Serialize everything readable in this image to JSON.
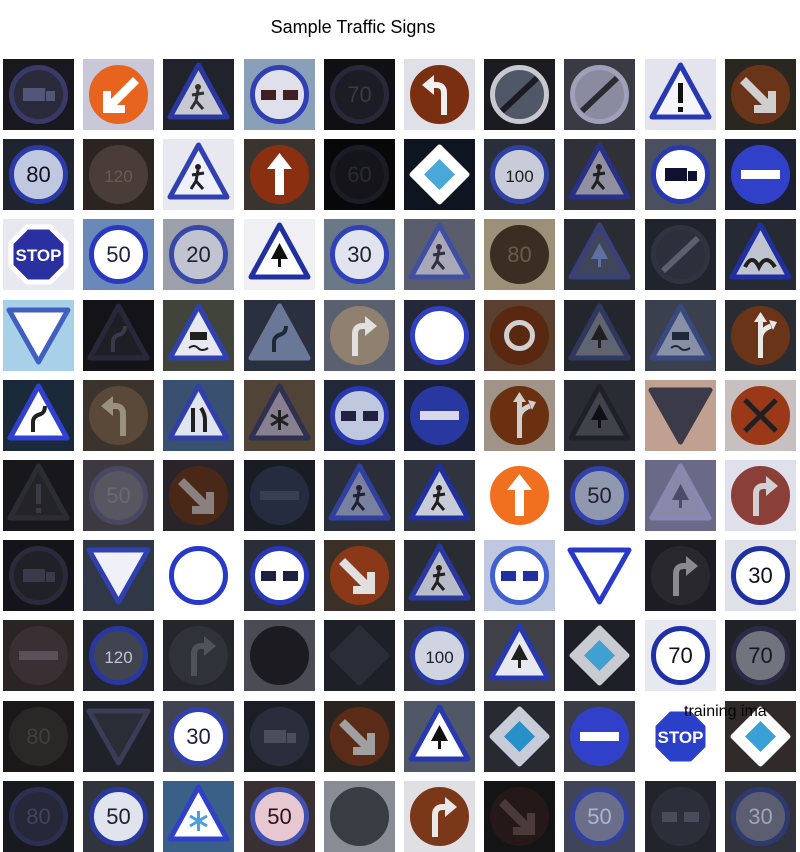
{
  "title": "Sample Traffic Signs",
  "caption": "training ima",
  "tiles": [
    {
      "shape": "circle",
      "sym": "truck",
      "bg": "#18181e",
      "fill": "#2a2a3a",
      "ring": "#3a3a6a",
      "ink": "#55557a"
    },
    {
      "shape": "circle",
      "sym": "arrow-dl",
      "bg": "#c8c8d8",
      "fill": "#e8641e",
      "ring": "#e8641e",
      "ink": "#ffffff"
    },
    {
      "shape": "triangle",
      "sym": "person",
      "bg": "#20222c",
      "fill": "#c8c8d0",
      "ring": "#2838a0",
      "ink": "#303030"
    },
    {
      "shape": "circle",
      "sym": "overtake",
      "bg": "#8aa0b8",
      "fill": "#e0e0ec",
      "ring": "#3040b0",
      "ink": "#402020"
    },
    {
      "shape": "circle",
      "sym": "70",
      "bg": "#101014",
      "fill": "#1c1c24",
      "ring": "#28283a",
      "ink": "#3a3a48"
    },
    {
      "shape": "circle",
      "sym": "curve-left",
      "bg": "#e0e0e8",
      "fill": "#7a3010",
      "ring": "#7a3010",
      "ink": "#f0f0f0"
    },
    {
      "shape": "circle",
      "sym": "noentry-diag",
      "bg": "#1a1c22",
      "fill": "#505868",
      "ring": "#c8c8d0",
      "ink": "#1a1c22"
    },
    {
      "shape": "circle",
      "sym": "end",
      "bg": "#3a3a44",
      "fill": "#8a8aa0",
      "ring": "#a0a0b8",
      "ink": "#2a2a30"
    },
    {
      "shape": "triangle",
      "sym": "excl",
      "bg": "#e4e4ee",
      "fill": "#f4f4fa",
      "ring": "#2838b0",
      "ink": "#101010"
    },
    {
      "shape": "circle",
      "sym": "arrow-dr",
      "bg": "#2a2620",
      "fill": "#6a3418",
      "ring": "#6a3418",
      "ink": "#cfcfcf"
    },
    {
      "shape": "circle",
      "sym": "80",
      "bg": "#20242e",
      "fill": "#c0c8e0",
      "ring": "#2a3aa8",
      "ink": "#101020"
    },
    {
      "shape": "circle",
      "sym": "120",
      "bg": "#2c2420",
      "fill": "#4a3c38",
      "ring": "#4a3c38",
      "ink": "#6a5a50"
    },
    {
      "shape": "triangle",
      "sym": "roadwork",
      "bg": "#e8e8f0",
      "fill": "#f0f0f8",
      "ring": "#3040b0",
      "ink": "#202020"
    },
    {
      "shape": "circle",
      "sym": "arrow-up",
      "bg": "#3a3430",
      "fill": "#8a3010",
      "ring": "#8a3010",
      "ink": "#ffffff"
    },
    {
      "shape": "circle",
      "sym": "60",
      "bg": "#08080a",
      "fill": "#14141a",
      "ring": "#1c1c26",
      "ink": "#2a2a34"
    },
    {
      "shape": "diamond",
      "sym": "priority",
      "bg": "#0e1420",
      "fill": "#ffffff",
      "ring": "#ffffff",
      "ink": "#4aa8d8"
    },
    {
      "shape": "circle",
      "sym": "100",
      "bg": "#2a2e38",
      "fill": "#c8ccd8",
      "ring": "#3040a0",
      "ink": "#202020"
    },
    {
      "shape": "triangle",
      "sym": "person",
      "bg": "#303038",
      "fill": "#9090a0",
      "ring": "#283088",
      "ink": "#202020"
    },
    {
      "shape": "circle",
      "sym": "truck",
      "bg": "#4a5060",
      "fill": "#ffffff",
      "ring": "#2838b0",
      "ink": "#101030"
    },
    {
      "shape": "circle",
      "sym": "noentry",
      "bg": "#1c2030",
      "fill": "#3040c8",
      "ring": "#3040c8",
      "ink": "#ffffff"
    },
    {
      "shape": "octagon",
      "sym": "stop",
      "bg": "#e8e8f0",
      "fill": "#2a30a0",
      "ring": "#ffffff",
      "ink": "#ffffff"
    },
    {
      "shape": "circle",
      "sym": "50",
      "bg": "#6a88b8",
      "fill": "#ffffff",
      "ring": "#2838c0",
      "ink": "#202040"
    },
    {
      "shape": "circle",
      "sym": "20",
      "bg": "#9ca0aa",
      "fill": "#c0c4d0",
      "ring": "#3848a8",
      "ink": "#202030"
    },
    {
      "shape": "triangle",
      "sym": "tree",
      "bg": "#f0f0f4",
      "fill": "#ffffff",
      "ring": "#2030a0",
      "ink": "#101010"
    },
    {
      "shape": "circle",
      "sym": "30",
      "bg": "#6a7888",
      "fill": "#e0e4ee",
      "ring": "#3040b8",
      "ink": "#202030"
    },
    {
      "shape": "triangle",
      "sym": "person",
      "bg": "#5a5e6c",
      "fill": "#a8a8b8",
      "ring": "#4050a0",
      "ink": "#303040"
    },
    {
      "shape": "circle",
      "sym": "80",
      "bg": "#9c9078",
      "fill": "#3a2e22",
      "ring": "#3a2e22",
      "ink": "#6a5a48"
    },
    {
      "shape": "triangle",
      "sym": "tree",
      "bg": "#2a2c34",
      "fill": "#40465a",
      "ring": "#3a4078",
      "ink": "#6070a0"
    },
    {
      "shape": "circle",
      "sym": "end",
      "bg": "#20242c",
      "fill": "#2c303a",
      "ring": "#303440",
      "ink": "#5a6070"
    },
    {
      "shape": "triangle",
      "sym": "bumps",
      "bg": "#262a34",
      "fill": "#c0c4d0",
      "ring": "#2030a0",
      "ink": "#202020"
    },
    {
      "shape": "triangle-down",
      "sym": "",
      "bg": "#a8d0e8",
      "fill": "#ffffff",
      "ring": "#4060c0",
      "ink": "#ffffff"
    },
    {
      "shape": "triangle",
      "sym": "curve",
      "bg": "#141418",
      "fill": "#1e1e24",
      "ring": "#28283a",
      "ink": "#3a3a4a"
    },
    {
      "shape": "triangle",
      "sym": "slip",
      "bg": "#40443a",
      "fill": "#e8e8f0",
      "ring": "#3040b0",
      "ink": "#202020"
    },
    {
      "shape": "triangle",
      "sym": "curve",
      "bg": "#2a3040",
      "fill": "#6a7898",
      "ring": "#6a7898",
      "ink": "#202838"
    },
    {
      "shape": "circle",
      "sym": "curve-right",
      "bg": "#5a6070",
      "fill": "#908070",
      "ring": "#908070",
      "ink": "#e0e0e0"
    },
    {
      "shape": "circle",
      "sym": "",
      "bg": "#24283a",
      "fill": "#ffffff",
      "ring": "#3040c0",
      "ink": "#ffffff"
    },
    {
      "shape": "circle",
      "sym": "roundabout",
      "bg": "#5a4030",
      "fill": "#5a2810",
      "ring": "#5a2810",
      "ink": "#d0d0d0"
    },
    {
      "shape": "triangle",
      "sym": "tree",
      "bg": "#24262e",
      "fill": "#606470",
      "ring": "#303860",
      "ink": "#202020"
    },
    {
      "shape": "triangle",
      "sym": "slip",
      "bg": "#3a404e",
      "fill": "#8890a8",
      "ring": "#3a4880",
      "ink": "#202838"
    },
    {
      "shape": "circle",
      "sym": "fork",
      "bg": "#2a2c34",
      "fill": "#6a3418",
      "ring": "#6a3418",
      "ink": "#e8e8e8"
    },
    {
      "shape": "triangle",
      "sym": "curve",
      "bg": "#1a2a3a",
      "fill": "#ffffff",
      "ring": "#3040d0",
      "ink": "#202020"
    },
    {
      "shape": "circle",
      "sym": "curve-left",
      "bg": "#3a342c",
      "fill": "#5a4838",
      "ring": "#5a4838",
      "ink": "#9a9080"
    },
    {
      "shape": "triangle",
      "sym": "narrow",
      "bg": "#3a5070",
      "fill": "#e0e4ee",
      "ring": "#3040a8",
      "ink": "#202020"
    },
    {
      "shape": "triangle",
      "sym": "snow",
      "bg": "#504438",
      "fill": "#888090",
      "ring": "#303050",
      "ink": "#202020"
    },
    {
      "shape": "circle",
      "sym": "overtake",
      "bg": "#20283a",
      "fill": "#c0c8e0",
      "ring": "#2838b0",
      "ink": "#202040"
    },
    {
      "shape": "circle",
      "sym": "noentry",
      "bg": "#1c2034",
      "fill": "#2838a0",
      "ring": "#2838a0",
      "ink": "#d8d8e8"
    },
    {
      "shape": "circle",
      "sym": "fork",
      "bg": "#a09488",
      "fill": "#6a3010",
      "ring": "#6a3010",
      "ink": "#d0d0d0"
    },
    {
      "shape": "triangle",
      "sym": "tree",
      "bg": "#2a2c34",
      "fill": "#40424c",
      "ring": "#202028",
      "ink": "#101014"
    },
    {
      "shape": "triangle-down",
      "sym": "",
      "bg": "#c0a090",
      "fill": "#3a3a48",
      "ring": "#3a3a48",
      "ink": "#3a3a48"
    },
    {
      "shape": "circle",
      "sym": "nostop",
      "bg": "#c8c0c0",
      "fill": "#9a3818",
      "ring": "#9a3818",
      "ink": "#202020"
    },
    {
      "shape": "triangle",
      "sym": "excl",
      "bg": "#18181c",
      "fill": "#242428",
      "ring": "#2c2c34",
      "ink": "#3a3a44"
    },
    {
      "shape": "circle",
      "sym": "50",
      "bg": "#3c3a40",
      "fill": "#585660",
      "ring": "#4a4860",
      "ink": "#6a6870"
    },
    {
      "shape": "circle",
      "sym": "arrow-dr",
      "bg": "#28242a",
      "fill": "#4a2818",
      "ring": "#4a2818",
      "ink": "#8a8080"
    },
    {
      "shape": "circle",
      "sym": "noentry",
      "bg": "#1a1c24",
      "fill": "#262c40",
      "ring": "#262c40",
      "ink": "#3a3e50"
    },
    {
      "shape": "triangle",
      "sym": "person",
      "bg": "#2a2e3a",
      "fill": "#7a80a0",
      "ring": "#3040a0",
      "ink": "#202030"
    },
    {
      "shape": "triangle",
      "sym": "roadwork",
      "bg": "#30343e",
      "fill": "#c8ccd8",
      "ring": "#2030a0",
      "ink": "#202020"
    },
    {
      "shape": "circle",
      "sym": "arrow-up",
      "bg": "#ffffff",
      "fill": "#f07020",
      "ring": "#f07020",
      "ink": "#ffffff"
    },
    {
      "shape": "circle",
      "sym": "50",
      "bg": "#2a2c32",
      "fill": "#9098b0",
      "ring": "#3040a8",
      "ink": "#202030"
    },
    {
      "shape": "triangle",
      "sym": "tree",
      "bg": "#6a6a88",
      "fill": "#8888a8",
      "ring": "#8888b0",
      "ink": "#4a4a6a"
    },
    {
      "shape": "circle",
      "sym": "curve-right",
      "bg": "#e0e0ec",
      "fill": "#8a4038",
      "ring": "#8a4038",
      "ink": "#d0d0d0"
    },
    {
      "shape": "circle",
      "sym": "truck",
      "bg": "#14141a",
      "fill": "#202028",
      "ring": "#2a2a3a",
      "ink": "#3a3a4a"
    },
    {
      "shape": "triangle-down",
      "sym": "",
      "bg": "#303848",
      "fill": "#f0f0f8",
      "ring": "#3040b0",
      "ink": "#ffffff"
    },
    {
      "shape": "circle",
      "sym": "",
      "bg": "#ffffff",
      "fill": "#ffffff",
      "ring": "#2838c8",
      "ink": "#ffffff"
    },
    {
      "shape": "circle",
      "sym": "overtake",
      "bg": "#2a2e38",
      "fill": "#ffffff",
      "ring": "#2838b8",
      "ink": "#202040"
    },
    {
      "shape": "circle",
      "sym": "arrow-dr",
      "bg": "#3a3028",
      "fill": "#8a3818",
      "ring": "#8a3818",
      "ink": "#e0e0e0"
    },
    {
      "shape": "triangle",
      "sym": "person",
      "bg": "#2a2c34",
      "fill": "#b8bcc8",
      "ring": "#2838a0",
      "ink": "#202020"
    },
    {
      "shape": "circle",
      "sym": "overtake",
      "bg": "#c0c8e0",
      "fill": "#ffffff",
      "ring": "#4060d0",
      "ink": "#2030a0"
    },
    {
      "shape": "triangle-down",
      "sym": "",
      "bg": "#ffffff",
      "fill": "#ffffff",
      "ring": "#2838c8",
      "ink": "#ffffff"
    },
    {
      "shape": "circle",
      "sym": "curve-right",
      "bg": "#1c1c22",
      "fill": "#28282e",
      "ring": "#28282e",
      "ink": "#8a8a90"
    },
    {
      "shape": "circle",
      "sym": "30",
      "bg": "#e0e0e8",
      "fill": "#ffffff",
      "ring": "#2030a0",
      "ink": "#101020"
    },
    {
      "shape": "circle",
      "sym": "noentry",
      "bg": "#2a2424",
      "fill": "#3a3034",
      "ring": "#3a3034",
      "ink": "#5a5058"
    },
    {
      "shape": "circle",
      "sym": "120",
      "bg": "#24262e",
      "fill": "#404450",
      "ring": "#2838a0",
      "ink": "#c0c4d0"
    },
    {
      "shape": "circle",
      "sym": "curve-right",
      "bg": "#24262c",
      "fill": "#30323a",
      "ring": "#30323a",
      "ink": "#50525a"
    },
    {
      "shape": "circle",
      "sym": "",
      "bg": "#4a4c54",
      "fill": "#1c1c20",
      "ring": "#1c1c20",
      "ink": "#1c1c20"
    },
    {
      "shape": "diamond",
      "sym": "",
      "bg": "#1e2028",
      "fill": "#2a2c38",
      "ring": "#2a2c38",
      "ink": "#3a3c48"
    },
    {
      "shape": "circle",
      "sym": "100",
      "bg": "#30343e",
      "fill": "#d0d4e0",
      "ring": "#2838a0",
      "ink": "#202030"
    },
    {
      "shape": "triangle",
      "sym": "tree",
      "bg": "#404048",
      "fill": "#e8e8f0",
      "ring": "#2838b0",
      "ink": "#202020"
    },
    {
      "shape": "diamond",
      "sym": "priority",
      "bg": "#1e2028",
      "fill": "#c8ccd0",
      "ring": "#c8ccd0",
      "ink": "#40a0d0"
    },
    {
      "shape": "circle",
      "sym": "70",
      "bg": "#e8e8f0",
      "fill": "#ffffff",
      "ring": "#2030a8",
      "ink": "#101020"
    },
    {
      "shape": "circle",
      "sym": "70",
      "bg": "#202228",
      "fill": "#70747e",
      "ring": "#2a2c44",
      "ink": "#181820"
    },
    {
      "shape": "circle",
      "sym": "80",
      "bg": "#1a1818",
      "fill": "#2a2826",
      "ring": "#2a2826",
      "ink": "#40403a"
    },
    {
      "shape": "triangle-down",
      "sym": "",
      "bg": "#20222a",
      "fill": "#2a2c36",
      "ring": "#3a3c58",
      "ink": "#2a2c36"
    },
    {
      "shape": "circle",
      "sym": "30",
      "bg": "#404452",
      "fill": "#ffffff",
      "ring": "#3040b0",
      "ink": "#202040"
    },
    {
      "shape": "circle",
      "sym": "truck",
      "bg": "#1c1e26",
      "fill": "#2a2e3c",
      "ring": "#2a2e3c",
      "ink": "#4a4e5c"
    },
    {
      "shape": "circle",
      "sym": "arrow-dr",
      "bg": "#2a2420",
      "fill": "#5a2c18",
      "ring": "#5a2c18",
      "ink": "#a0a0a0"
    },
    {
      "shape": "triangle",
      "sym": "tree",
      "bg": "#505868",
      "fill": "#ffffff",
      "ring": "#2838b0",
      "ink": "#101010"
    },
    {
      "shape": "diamond",
      "sym": "priority",
      "bg": "#282a32",
      "fill": "#c8ccd8",
      "ring": "#c8ccd8",
      "ink": "#2890c8"
    },
    {
      "shape": "circle",
      "sym": "noentry",
      "bg": "#3a3c48",
      "fill": "#3040c8",
      "ring": "#3040c8",
      "ink": "#ffffff"
    },
    {
      "shape": "octagon",
      "sym": "stop",
      "bg": "#ffffff",
      "fill": "#2a40c8",
      "ring": "#ffffff",
      "ink": "#ffffff"
    },
    {
      "shape": "diamond",
      "sym": "priority",
      "bg": "#302a2a",
      "fill": "#ffffff",
      "ring": "#ffffff",
      "ink": "#3aa0d8"
    },
    {
      "shape": "circle",
      "sym": "80",
      "bg": "#181a20",
      "fill": "#26283a",
      "ring": "#2c3050",
      "ink": "#40445a"
    },
    {
      "shape": "circle",
      "sym": "50",
      "bg": "#30343c",
      "fill": "#e0e4ec",
      "ring": "#2838a0",
      "ink": "#202030"
    },
    {
      "shape": "triangle",
      "sym": "snow",
      "bg": "#3a6088",
      "fill": "#ffffff",
      "ring": "#3040c8",
      "ink": "#4aa0d8"
    },
    {
      "shape": "circle",
      "sym": "50",
      "bg": "#3a3034",
      "fill": "#e8c8d0",
      "ring": "#4050b0",
      "ink": "#301020"
    },
    {
      "shape": "circle",
      "sym": "",
      "bg": "#888c94",
      "fill": "#3a3c44",
      "ring": "#3a3c44",
      "ink": "#3a3c44"
    },
    {
      "shape": "circle",
      "sym": "curve-right",
      "bg": "#e0e0e4",
      "fill": "#7a3818",
      "ring": "#7a3818",
      "ink": "#e8e8e8"
    },
    {
      "shape": "circle",
      "sym": "arrow-dr",
      "bg": "#141416",
      "fill": "#241818",
      "ring": "#241818",
      "ink": "#4a3a3a"
    },
    {
      "shape": "circle",
      "sym": "50",
      "bg": "#404458",
      "fill": "#6a6e8a",
      "ring": "#3040a0",
      "ink": "#b0b4c8"
    },
    {
      "shape": "circle",
      "sym": "overtake",
      "bg": "#22242c",
      "fill": "#2c2e3a",
      "ring": "#2c2e3a",
      "ink": "#4a4c5c"
    },
    {
      "shape": "circle",
      "sym": "30",
      "bg": "#30323c",
      "fill": "#5a5e70",
      "ring": "#303870",
      "ink": "#a0a4b8"
    }
  ]
}
